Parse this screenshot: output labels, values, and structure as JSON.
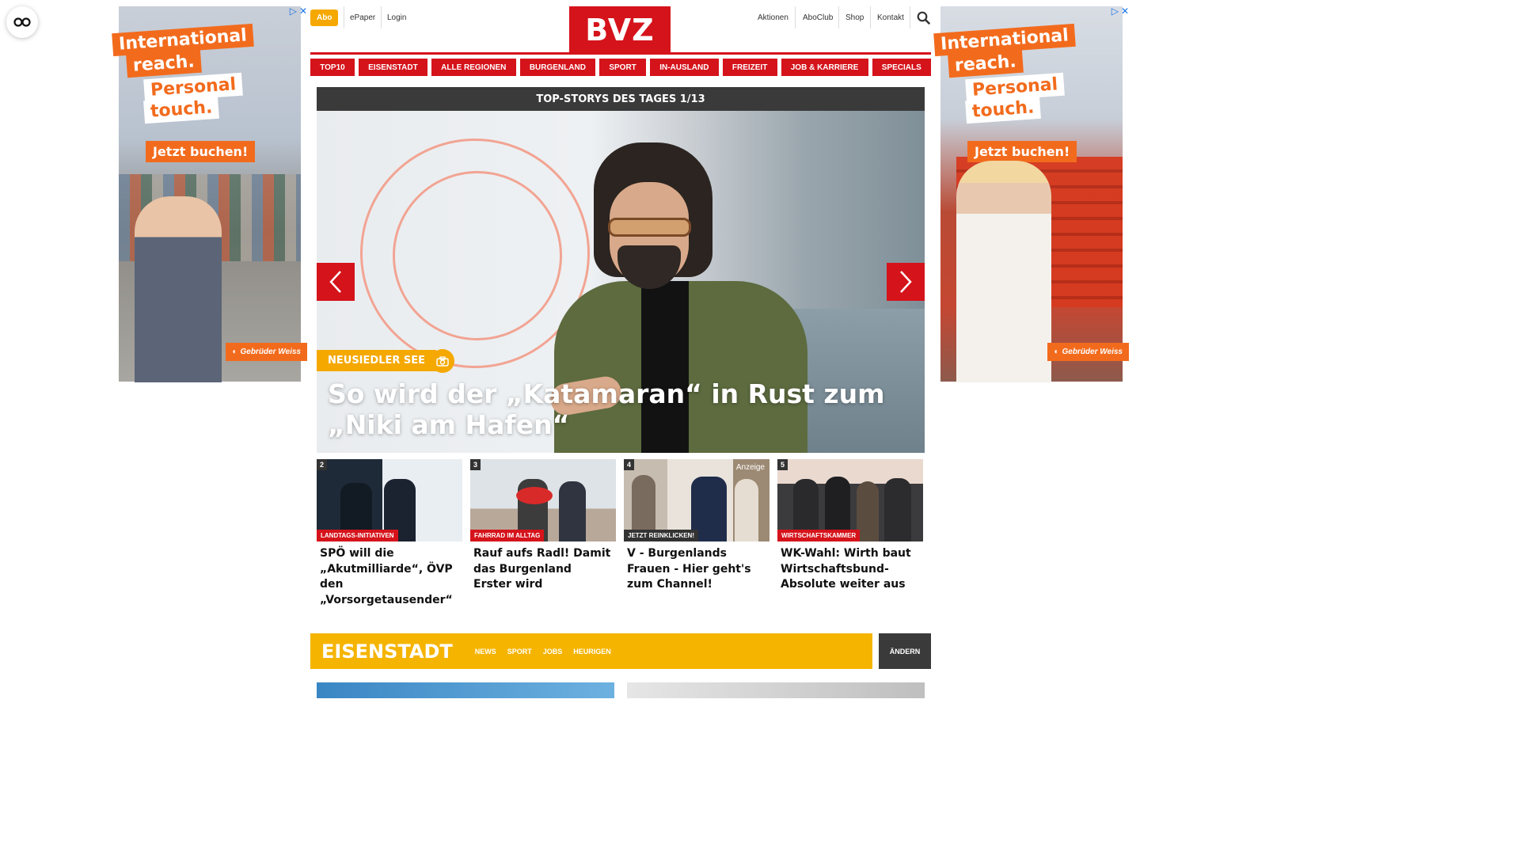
{
  "ads": {
    "line1": "International",
    "line2": "reach.",
    "line3": "Personal",
    "line4": "touch.",
    "cta": "Jetzt buchen!",
    "brand": "Gebrüder Weiss"
  },
  "header": {
    "abo": "Abo",
    "epaper": "ePaper",
    "login": "Login",
    "logo": "BVZ",
    "right_links": [
      "Aktionen",
      "AboClub",
      "Shop",
      "Kontakt"
    ],
    "accent_color": "#d5131b"
  },
  "nav": [
    "TOP10",
    "EISENSTADT",
    "ALLE REGIONEN",
    "BURGENLAND",
    "SPORT",
    "IN-AUSLAND",
    "FREIZEIT",
    "JOB & KARRIERE",
    "SPECIALS"
  ],
  "top_stories": {
    "bar_title": "TOP-STORYS DES TAGES 1/13",
    "hero": {
      "category": "NEUSIEDLER SEE",
      "title": "So wird der „Katamaran“ in Rust zum „Niki am Hafen“"
    },
    "cards": [
      {
        "num": "2",
        "category": "LANDTAGS-INITIATIVEN",
        "title": "SPÖ will die „Akutmilliarde“, ÖVP den „Vorsorgetausender“"
      },
      {
        "num": "3",
        "category": "FAHRRAD IM ALLTAG",
        "title": "Rauf aufs Radl! Damit das Burgenland Erster wird"
      },
      {
        "num": "4",
        "category": "JETZT REINKLICKEN!",
        "badge": "Anzeige",
        "title": "V - Burgenlands Frauen - Hier geht's zum Channel!"
      },
      {
        "num": "5",
        "category": "WIRTSCHAFTSKAMMER",
        "title": "WK-Wahl: Wirth baut Wirtschaftsbund-Absolute weiter aus"
      }
    ]
  },
  "region": {
    "title": "EISENSTADT",
    "links": [
      "NEWS",
      "SPORT",
      "JOBS",
      "HEURIGEN"
    ],
    "change_button": "ÄNDERN"
  }
}
